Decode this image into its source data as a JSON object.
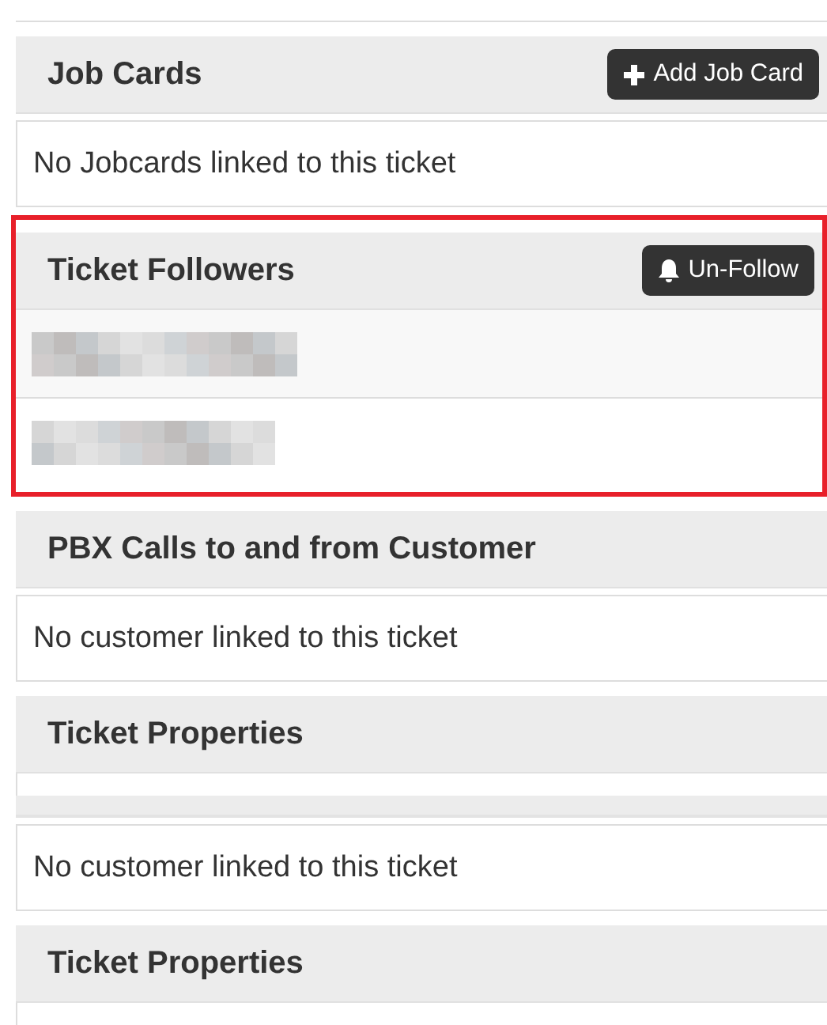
{
  "blocks": [
    {
      "kind": "edge"
    },
    {
      "kind": "header",
      "title": "Job Cards",
      "button": {
        "kind": "add",
        "label": "Add Job Card"
      }
    },
    {
      "kind": "message",
      "text": "No Jobcards linked to this ticket"
    },
    {
      "kind": "followers",
      "highlighted": true,
      "title": "Ticket Followers",
      "button": {
        "kind": "unfollow",
        "label": "Un-Follow"
      },
      "rows": [
        {
          "kind": "redacted"
        },
        {
          "kind": "redacted"
        }
      ]
    },
    {
      "kind": "header",
      "title": "PBX Calls to and from Customer"
    },
    {
      "kind": "message",
      "text": "No customer linked to this ticket"
    },
    {
      "kind": "header",
      "title": "Ticket Properties"
    },
    {
      "kind": "blank"
    },
    {
      "kind": "strip"
    },
    {
      "kind": "message",
      "text": "No customer linked to this ticket"
    },
    {
      "kind": "header",
      "title": "Ticket Properties"
    },
    {
      "kind": "blank"
    }
  ]
}
